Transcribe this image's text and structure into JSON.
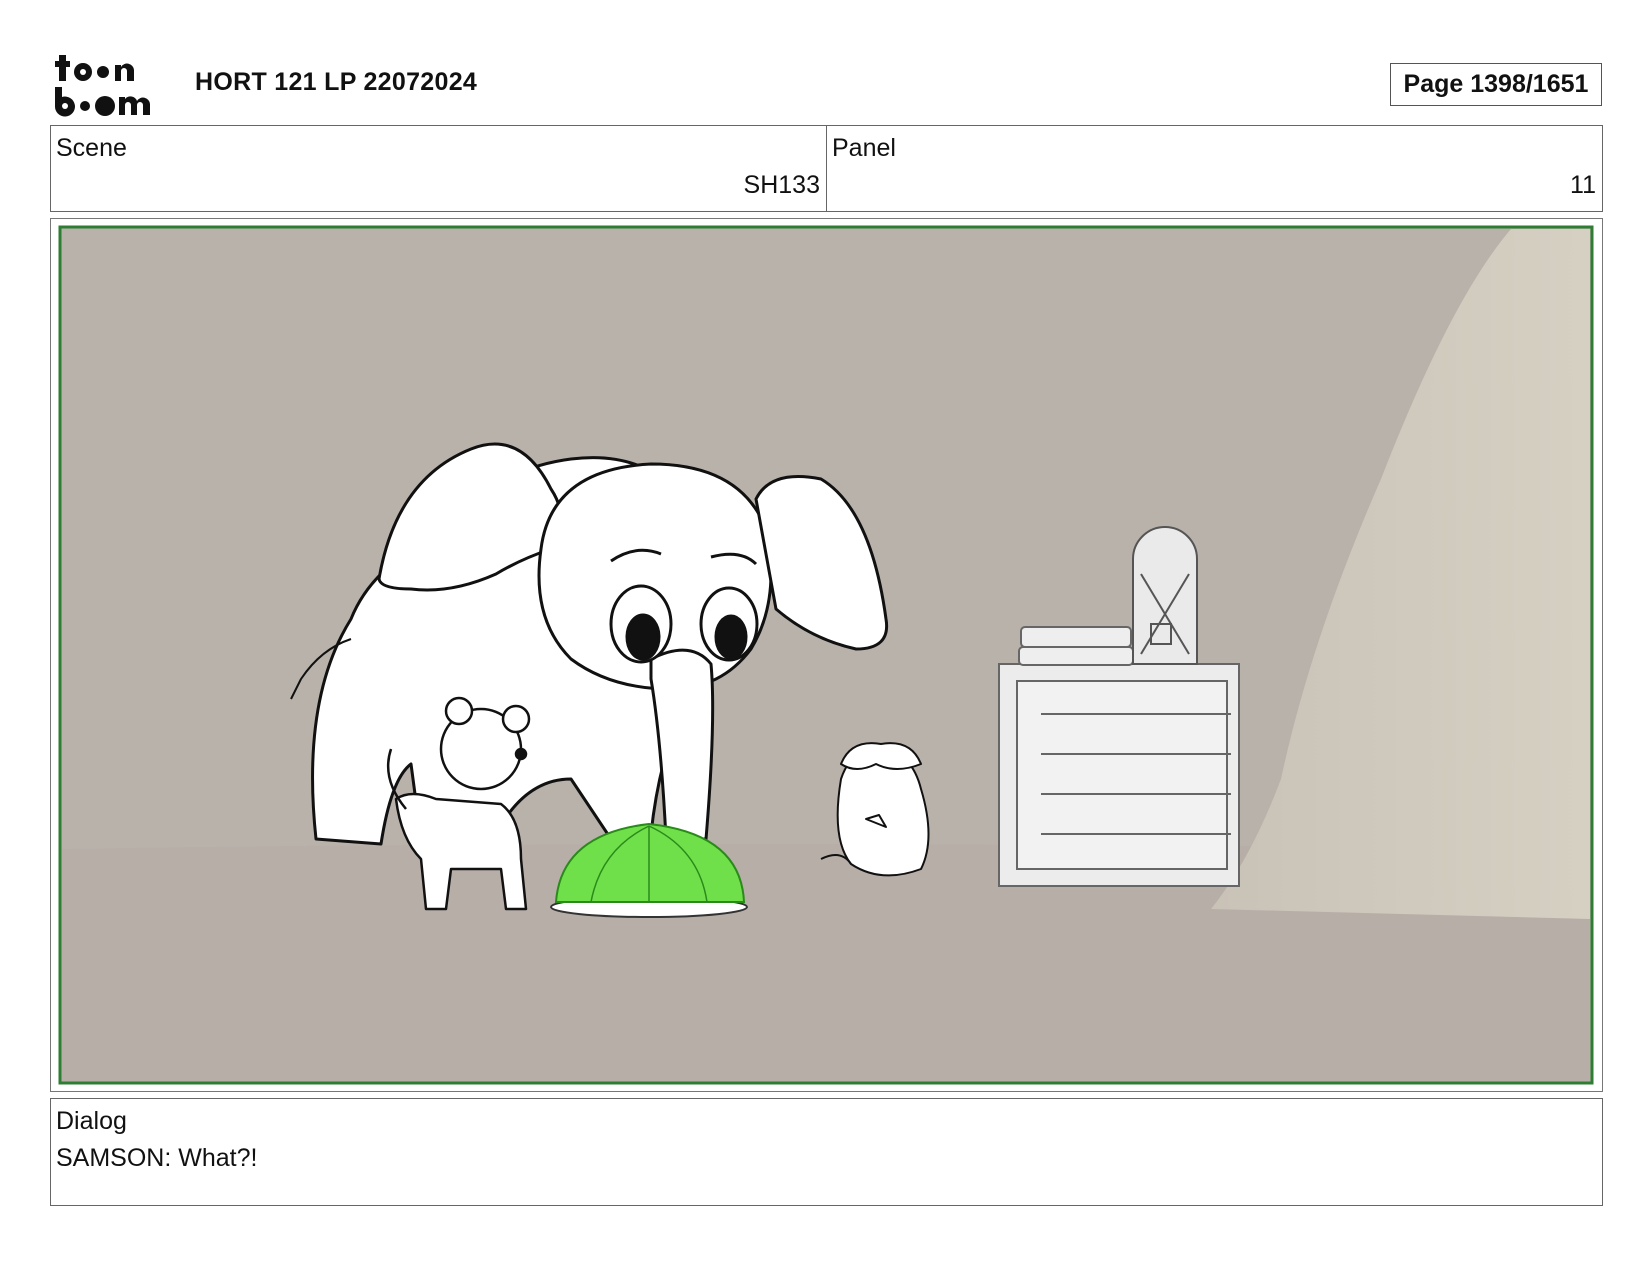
{
  "header": {
    "logo_text": "toon boom",
    "title": "HORT 121 LP 22072024",
    "page": "Page 1398/1651"
  },
  "info": {
    "scene_label": "Scene",
    "scene_value": "SH133",
    "panel_label": "Panel",
    "panel_value": "11"
  },
  "artwork": {
    "description_icon": "storyboard-drawing",
    "colors": {
      "frame_border": "#2e7d32",
      "background": "#b9b2ab",
      "jelly": "#6fe04a"
    }
  },
  "dialog": {
    "label": "Dialog",
    "text": "SAMSON: What?!"
  }
}
